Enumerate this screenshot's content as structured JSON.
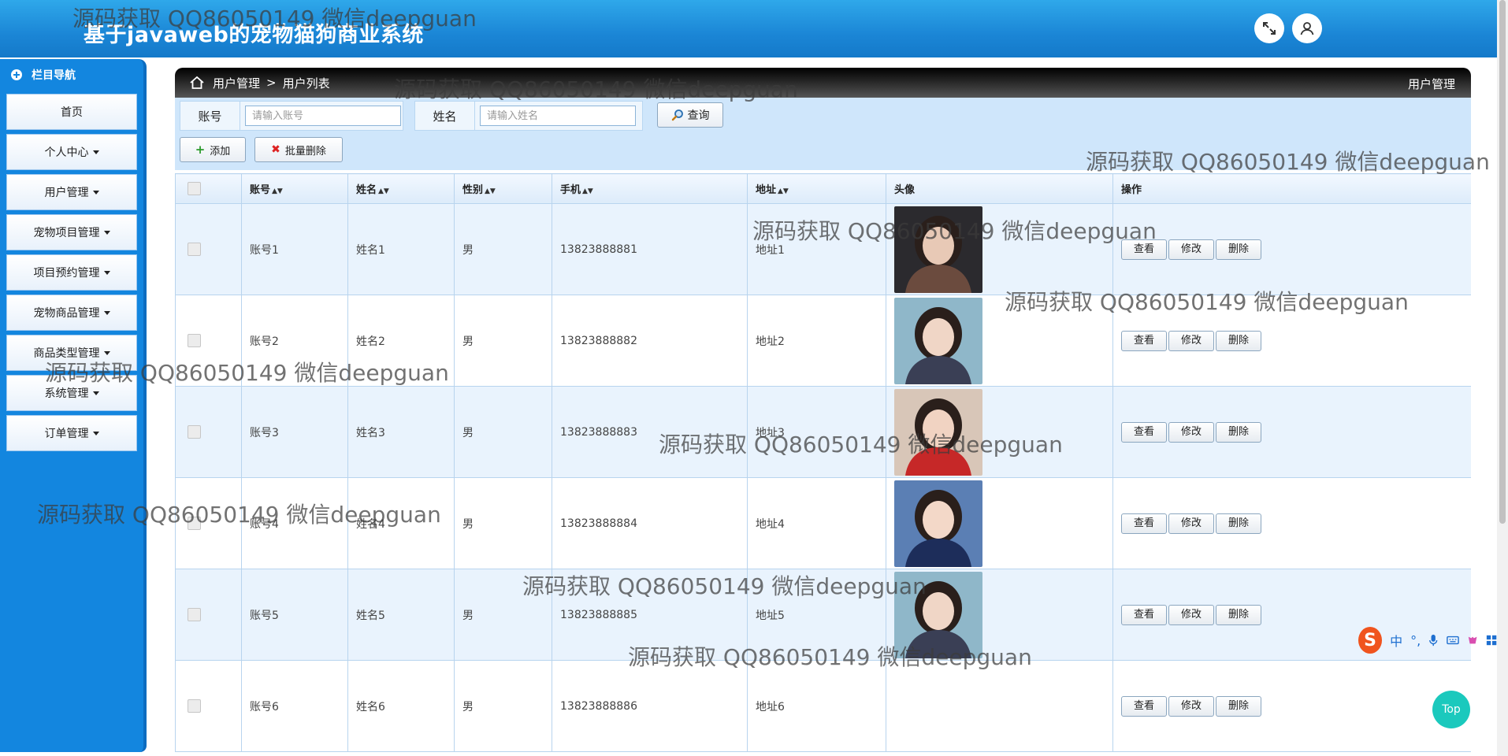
{
  "header": {
    "title": "基于javaweb的宠物猫狗商业系统",
    "fullscreen_icon": "expand-icon",
    "user_icon": "user-icon"
  },
  "sidebar": {
    "title": "栏目导航",
    "items": [
      {
        "label": "首页",
        "dropdown": false
      },
      {
        "label": "个人中心",
        "dropdown": true
      },
      {
        "label": "用户管理",
        "dropdown": true
      },
      {
        "label": "宠物项目管理",
        "dropdown": true
      },
      {
        "label": "项目预约管理",
        "dropdown": true
      },
      {
        "label": "宠物商品管理",
        "dropdown": true
      },
      {
        "label": "商品类型管理",
        "dropdown": true
      },
      {
        "label": "系统管理",
        "dropdown": true
      },
      {
        "label": "订单管理",
        "dropdown": true
      }
    ]
  },
  "breadcrumb": {
    "items": [
      "用户管理",
      ">",
      "用户列表"
    ],
    "right_title": "用户管理"
  },
  "search": {
    "account_label": "账号",
    "account_placeholder": "请输入账号",
    "name_label": "姓名",
    "name_placeholder": "请输入姓名",
    "query_label": "查询"
  },
  "actions": {
    "add_label": "添加",
    "batch_delete_label": "批量删除"
  },
  "table": {
    "columns": [
      "账号",
      "姓名",
      "性别",
      "手机",
      "地址",
      "头像",
      "操作"
    ],
    "rows": [
      {
        "account": "账号1",
        "name": "姓名1",
        "gender": "男",
        "phone": "13823888881",
        "address": "地址1",
        "has_avatar": true
      },
      {
        "account": "账号2",
        "name": "姓名2",
        "gender": "男",
        "phone": "13823888882",
        "address": "地址2",
        "has_avatar": true
      },
      {
        "account": "账号3",
        "name": "姓名3",
        "gender": "男",
        "phone": "13823888883",
        "address": "地址3",
        "has_avatar": true
      },
      {
        "account": "账号4",
        "name": "姓名4",
        "gender": "男",
        "phone": "13823888884",
        "address": "地址4",
        "has_avatar": true
      },
      {
        "account": "账号5",
        "name": "姓名5",
        "gender": "男",
        "phone": "13823888885",
        "address": "地址5",
        "has_avatar": true
      },
      {
        "account": "账号6",
        "name": "姓名6",
        "gender": "男",
        "phone": "13823888886",
        "address": "地址6",
        "has_avatar": false
      }
    ],
    "ops": [
      "查看",
      "修改",
      "删除"
    ]
  },
  "watermark": "源码获取 QQ86050149 微信deepguan",
  "top_button": "Top",
  "ime": {
    "logo": "S",
    "lang": "中",
    "punct": "°,"
  },
  "colors": {
    "header": "#1b86d6",
    "sidebar": "#1386df",
    "toolbar": "#cfe6fb",
    "top_button": "#1bc9bd"
  }
}
